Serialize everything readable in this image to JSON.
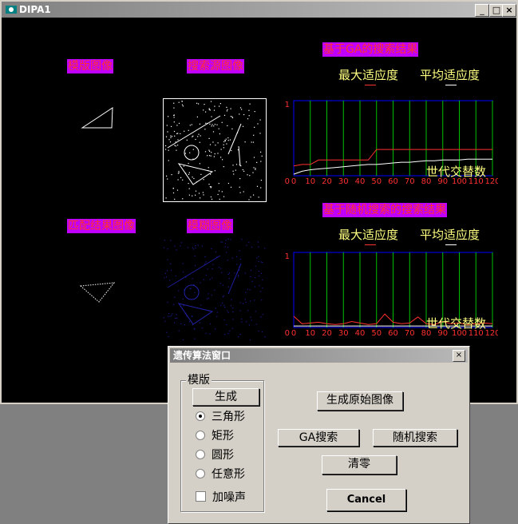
{
  "window": {
    "title": "DIPA1"
  },
  "panels": {
    "template_image": "模版图像",
    "search_source_image": "搜索源图像",
    "match_result_image": "匹配结果图像",
    "blurred_image": "模糊图像"
  },
  "ga_chart": {
    "title": "基于GA的搜索结果",
    "legend_max": "最大适应度",
    "legend_avg": "平均适应度",
    "caption": "世代交替数",
    "colors": {
      "max": "#ff3030",
      "avg": "#ffffff",
      "grid": "#00c000",
      "frame": "#0000ff"
    }
  },
  "random_chart": {
    "title": "基于随机搜索的搜索结果",
    "legend_max": "最大适应度",
    "legend_avg": "平均适应度",
    "caption": "世代交替数"
  },
  "chart_data": [
    {
      "type": "line",
      "x": [
        0,
        5,
        10,
        15,
        20,
        25,
        30,
        35,
        40,
        45,
        50,
        55,
        60,
        65,
        70,
        75,
        80,
        85,
        90,
        95,
        100,
        105,
        110,
        115,
        120
      ],
      "xticks": [
        "0",
        "10",
        "20",
        "30",
        "40",
        "50",
        "60",
        "70",
        "80",
        "90",
        "100",
        "110",
        "120"
      ],
      "yticks": [
        "1",
        "0"
      ],
      "ylim": [
        0,
        1
      ],
      "series": [
        {
          "name": "最大适应度",
          "values": [
            0.13,
            0.15,
            0.15,
            0.21,
            0.21,
            0.21,
            0.21,
            0.21,
            0.21,
            0.21,
            0.35,
            0.35,
            0.35,
            0.35,
            0.35,
            0.35,
            0.35,
            0.35,
            0.35,
            0.35,
            0.35,
            0.35,
            0.35,
            0.35,
            0.35
          ]
        },
        {
          "name": "平均适应度",
          "values": [
            0.02,
            0.06,
            0.08,
            0.09,
            0.1,
            0.11,
            0.12,
            0.13,
            0.14,
            0.15,
            0.15,
            0.16,
            0.17,
            0.18,
            0.18,
            0.19,
            0.2,
            0.2,
            0.21,
            0.21,
            0.21,
            0.22,
            0.22,
            0.22,
            0.22
          ]
        }
      ],
      "title": "基于GA的搜索结果",
      "xlabel": "世代交替数"
    },
    {
      "type": "line",
      "x": [
        0,
        5,
        10,
        15,
        20,
        25,
        30,
        35,
        40,
        45,
        50,
        55,
        60,
        65,
        70,
        75,
        80,
        85,
        90,
        95,
        100,
        105,
        110,
        115,
        120
      ],
      "xticks": [
        "0",
        "10",
        "20",
        "30",
        "40",
        "50",
        "60",
        "70",
        "80",
        "90",
        "100",
        "110",
        "120"
      ],
      "yticks": [
        "1",
        "0"
      ],
      "ylim": [
        0,
        1
      ],
      "series": [
        {
          "name": "最大适应度",
          "values": [
            0.15,
            0.05,
            0.06,
            0.07,
            0.05,
            0.04,
            0.05,
            0.08,
            0.06,
            0.04,
            0.05,
            0.18,
            0.07,
            0.05,
            0.06,
            0.14,
            0.05,
            0.04,
            0.08,
            0.05,
            0.06,
            0.04,
            0.05,
            0.06,
            0.05
          ]
        },
        {
          "name": "平均适应度",
          "values": [
            0.02,
            0.02,
            0.02,
            0.02,
            0.02,
            0.02,
            0.02,
            0.02,
            0.02,
            0.02,
            0.02,
            0.02,
            0.02,
            0.02,
            0.02,
            0.02,
            0.02,
            0.02,
            0.02,
            0.02,
            0.02,
            0.02,
            0.02,
            0.02,
            0.02
          ]
        }
      ],
      "title": "基于随机搜索的搜索结果",
      "xlabel": "世代交替数"
    }
  ],
  "dialog": {
    "title": "遗传算法窗口",
    "group_label": "模版",
    "generate_button": "生成",
    "shapes": [
      "三角形",
      "矩形",
      "圆形",
      "任意形"
    ],
    "selected_shape": "三角形",
    "add_noise_label": "加噪声",
    "generate_source_button": "生成原始图像",
    "ga_search_button": "GA搜索",
    "random_search_button": "随机搜索",
    "clear_button": "清零",
    "cancel_button": "Cancel"
  }
}
